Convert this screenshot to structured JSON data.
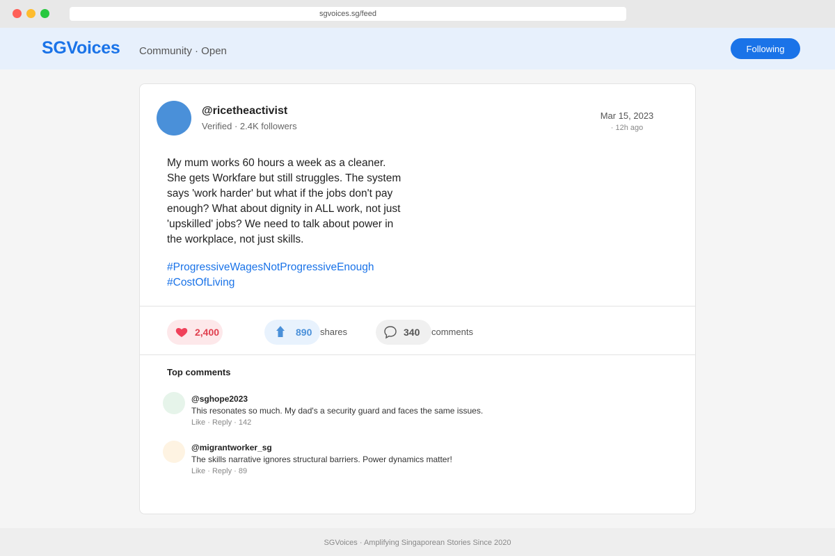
{
  "browser": {
    "url": "sgvoices.sg/feed"
  },
  "header": {
    "logo": "SGVoices",
    "community": "Community · Open",
    "follow_button": "Following"
  },
  "post": {
    "username": "@ricetheactivist",
    "user_info": "Verified · 2.4K followers",
    "date": "Mar 15, 2023",
    "time_ago": "· 12h ago",
    "body_lines": [
      "My mum works 60 hours a week as a cleaner.",
      "She gets Workfare but still struggles. The system",
      "says 'work harder' but what if the jobs don't pay",
      "enough? What about dignity in ALL work, not just",
      "'upskilled' jobs? We need to talk about power in",
      "the workplace, not just skills."
    ],
    "hashtags": [
      "#ProgressiveWagesNotProgressiveEnough",
      "#CostOfLiving"
    ]
  },
  "reactions": {
    "likes": "2,400",
    "shares": "890",
    "shares_label": "shares",
    "comments": "340",
    "comments_label": "comments"
  },
  "comments_section": {
    "title": "Top comments",
    "items": [
      {
        "user": "@sghope2023",
        "text": "This resonates so much. My dad's a security guard and faces the same issues.",
        "like": "Like",
        "reply": "Reply",
        "count": "142"
      },
      {
        "user": "@migrantworker_sg",
        "text": "The skills narrative ignores structural barriers. Power dynamics matter!",
        "like": "Like",
        "reply": "Reply",
        "count": "89"
      }
    ]
  },
  "footer": {
    "text": "SGVoices · Amplifying Singaporean Stories Since 2020"
  },
  "colors": {
    "brand": "#1a73e8",
    "like": "#e0404f",
    "share": "#4a90d9",
    "avatar": "#4a90d9"
  },
  "icons": {
    "like": "heart-icon",
    "share": "share-arrow-icon",
    "comment": "speech-bubble-icon"
  }
}
